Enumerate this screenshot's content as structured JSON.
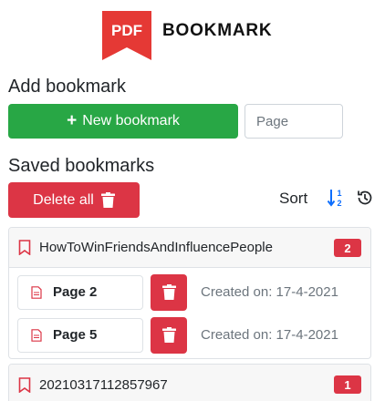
{
  "logo": {
    "badge_text": "PDF",
    "title": "BOOKMARK",
    "badge_color": "#e53935"
  },
  "add_section": {
    "heading": "Add bookmark",
    "new_button_label": "New bookmark",
    "page_placeholder": "Page",
    "button_color": "#28a745"
  },
  "saved_section": {
    "heading": "Saved bookmarks",
    "delete_all_label": "Delete all",
    "sort_label": "Sort",
    "danger_color": "#dc3545",
    "accent_color": "#0d6efd"
  },
  "documents": [
    {
      "name": "HowToWinFriendsAndInfluencePeople",
      "count": "2",
      "bookmarks": [
        {
          "page": "Page 2",
          "created": "Created on: 17-4-2021"
        },
        {
          "page": "Page 5",
          "created": "Created on: 17-4-2021"
        }
      ]
    },
    {
      "name": "20210317112857967",
      "count": "1",
      "bookmarks": []
    }
  ]
}
